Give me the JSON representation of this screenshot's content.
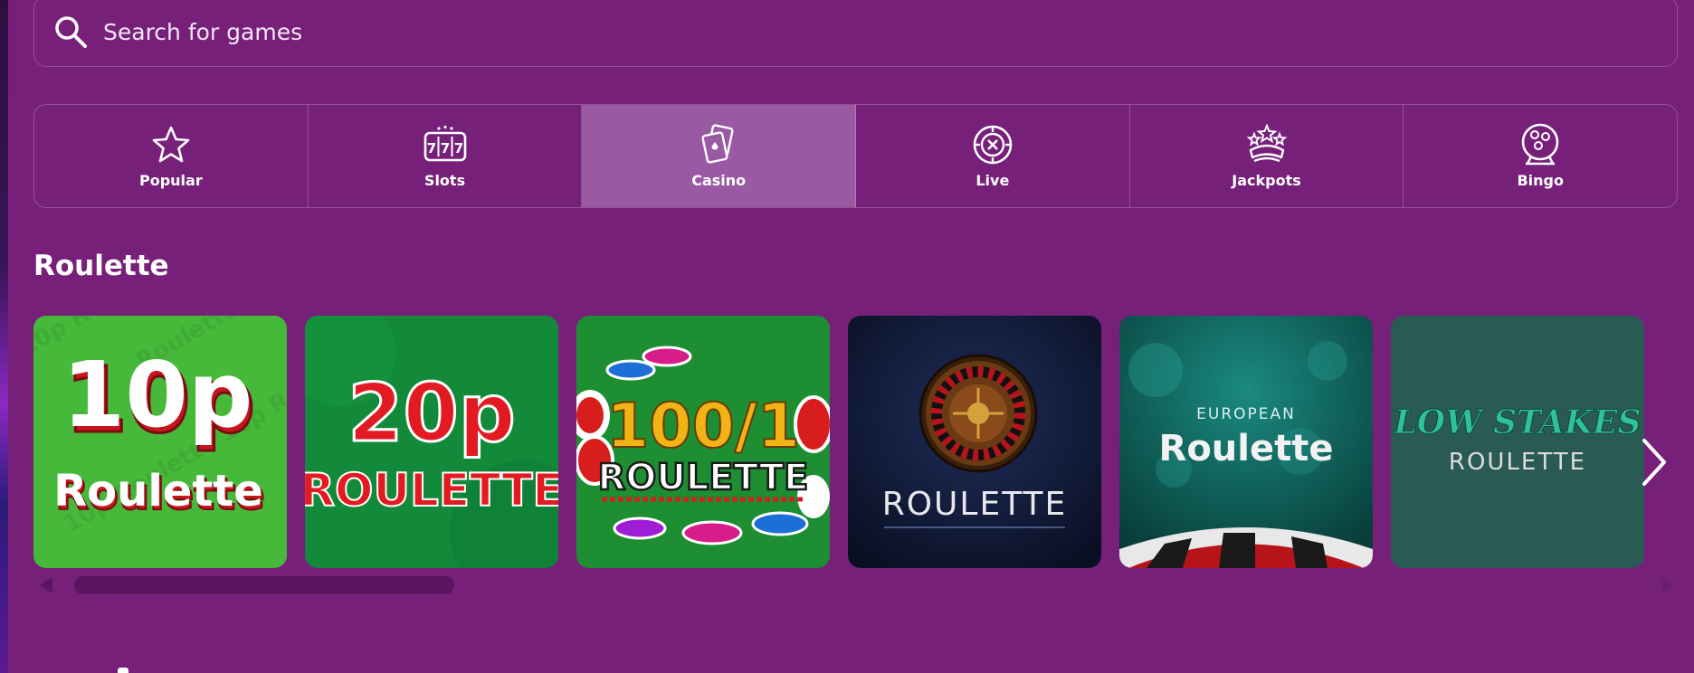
{
  "search": {
    "placeholder": "Search for games"
  },
  "categories": [
    {
      "label": "Popular",
      "icon": "star-icon",
      "active": false
    },
    {
      "label": "Slots",
      "icon": "slot-777-icon",
      "active": false
    },
    {
      "label": "Casino",
      "icon": "cards-icon",
      "active": true
    },
    {
      "label": "Live",
      "icon": "chip-icon",
      "active": false
    },
    {
      "label": "Jackpots",
      "icon": "jackpot-crown-icon",
      "active": false
    },
    {
      "label": "Bingo",
      "icon": "bingo-ball-icon",
      "active": false
    }
  ],
  "section": {
    "title": "Roulette"
  },
  "games": [
    {
      "line1": "10p",
      "line2": "Roulette",
      "bg": "#46b83a"
    },
    {
      "line1": "20p",
      "line2": "ROULETTE",
      "bg": "#138a3a"
    },
    {
      "line1": "100/1",
      "line2": "ROULETTE",
      "bg": "#1d8f32"
    },
    {
      "line1": "ROULETTE",
      "bg": "#101a3a"
    },
    {
      "line1": "EUROPEAN",
      "line2": "Roulette",
      "bg": "#0f5a58"
    },
    {
      "line1": "LOW STAKES",
      "line2": "ROULETTE",
      "bg": "#2a5a54"
    }
  ],
  "colors": {
    "background": "#77207a",
    "active_tab": "#9a5aa3",
    "scroll_thumb": "#5a1560"
  }
}
